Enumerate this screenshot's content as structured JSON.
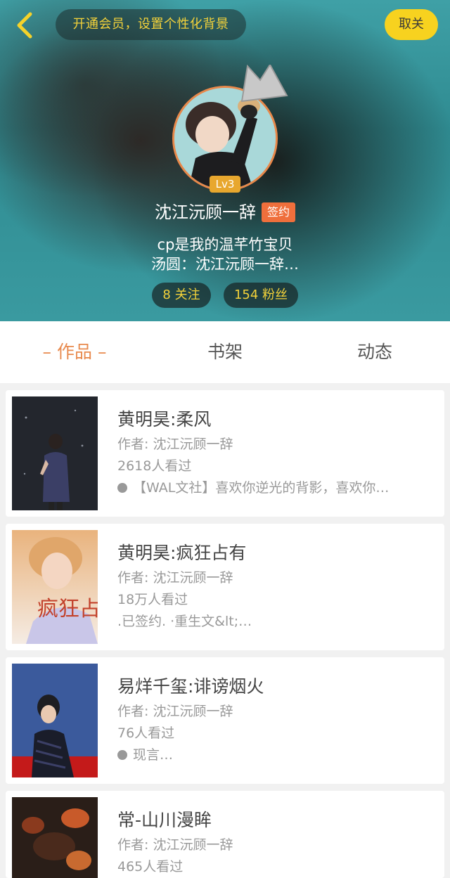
{
  "header": {
    "vip_banner": "开通会员，设置个性化背景",
    "unfollow_label": "取关",
    "level": "Lv3",
    "username": "沈江沅顾一辞",
    "signed_badge": "签约",
    "bio_line1": "cp是我的温芊竹宝贝",
    "bio_line2": "汤圆：沈江沅顾一辞…",
    "follow_stat": "8 关注",
    "fans_stat": "154 粉丝"
  },
  "tabs": [
    {
      "label": "– 作品 –",
      "active": true
    },
    {
      "label": "书架",
      "active": false
    },
    {
      "label": "动态",
      "active": false
    }
  ],
  "books": [
    {
      "title": "黄明昊:柔风",
      "author": "作者: 沈江沅顾一辞",
      "views": "2618人看过",
      "desc": "【WAL文社】喜欢你逆光的背影，喜欢你…",
      "has_dot": true
    },
    {
      "title": "黄明昊:疯狂占有",
      "author": "作者: 沈江沅顾一辞",
      "views": "18万人看过",
      "desc": ".已签约. ·重生文&lt;…",
      "has_dot": false,
      "cover_text": "疯狂占有"
    },
    {
      "title": "易烊千玺:诽谤烟火",
      "author": "作者: 沈江沅顾一辞",
      "views": "76人看过",
      "desc": "现言…",
      "has_dot": true
    },
    {
      "title": "常-山川漫眸",
      "author": "作者: 沈江沅顾一辞",
      "views": "465人看过",
      "desc": "",
      "has_dot": false
    }
  ],
  "colors": {
    "accent": "#e88a4e",
    "yellow": "#f7d21f",
    "badge": "#ef6f3c"
  },
  "icons": [
    "back-chevron-icon",
    "crown-icon"
  ]
}
